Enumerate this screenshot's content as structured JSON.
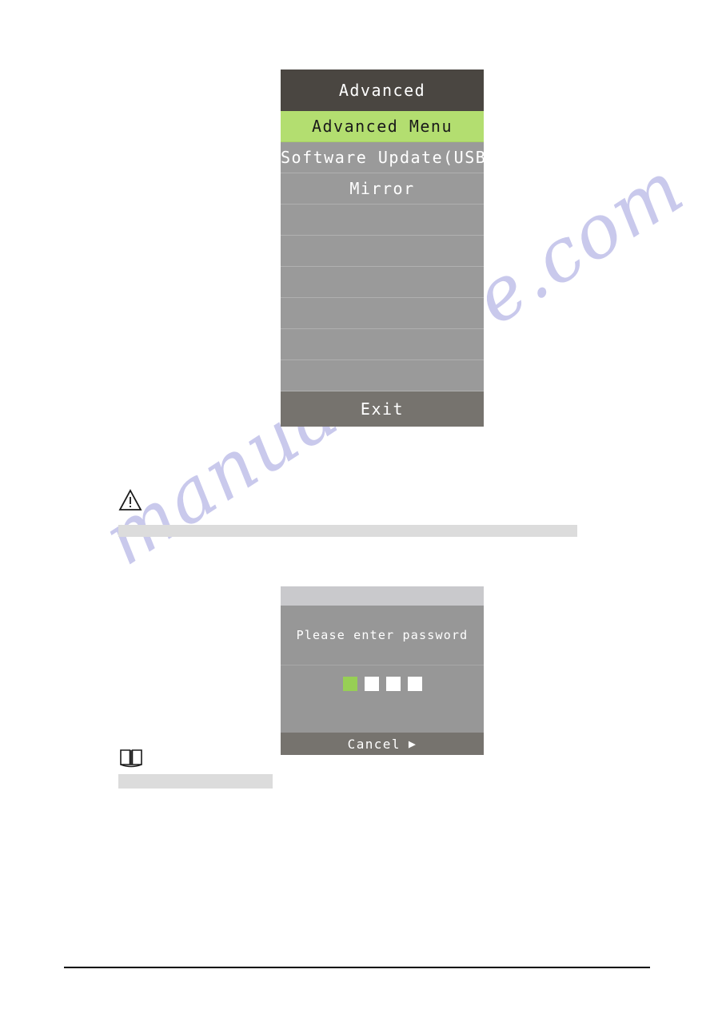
{
  "watermark": {
    "text": "manualshive.com"
  },
  "osd_menu": {
    "title": "Advanced",
    "rows": [
      {
        "label": "Advanced Menu",
        "state": "selected"
      },
      {
        "label": "Software Update(USB)",
        "state": "normal"
      },
      {
        "label": "Mirror",
        "state": "normal"
      },
      {
        "label": "",
        "state": "blank"
      },
      {
        "label": "",
        "state": "blank"
      },
      {
        "label": "",
        "state": "blank"
      },
      {
        "label": "",
        "state": "blank"
      },
      {
        "label": "",
        "state": "blank"
      },
      {
        "label": "",
        "state": "blank"
      }
    ],
    "exit_label": "Exit",
    "colors": {
      "header_bg": "#4a4641",
      "row_bg": "#9a9a9a",
      "selected_bg": "#b3de70",
      "footer_bg": "#76736e",
      "text": "#ffffff"
    }
  },
  "warning_note": {
    "icon": "warning-triangle-icon"
  },
  "tip_note": {
    "icon": "open-book-icon"
  },
  "password_dialog": {
    "prompt": "Please enter password",
    "boxes": [
      {
        "state": "active"
      },
      {
        "state": "empty"
      },
      {
        "state": "empty"
      },
      {
        "state": "empty"
      }
    ],
    "cancel_label": "Cancel",
    "cancel_arrow": "▶",
    "colors": {
      "titlebar_bg": "#c9c9cc",
      "body_bg": "#979797",
      "footer_bg": "#76736e",
      "active_box": "#97cf55",
      "empty_box": "#ffffff"
    }
  }
}
